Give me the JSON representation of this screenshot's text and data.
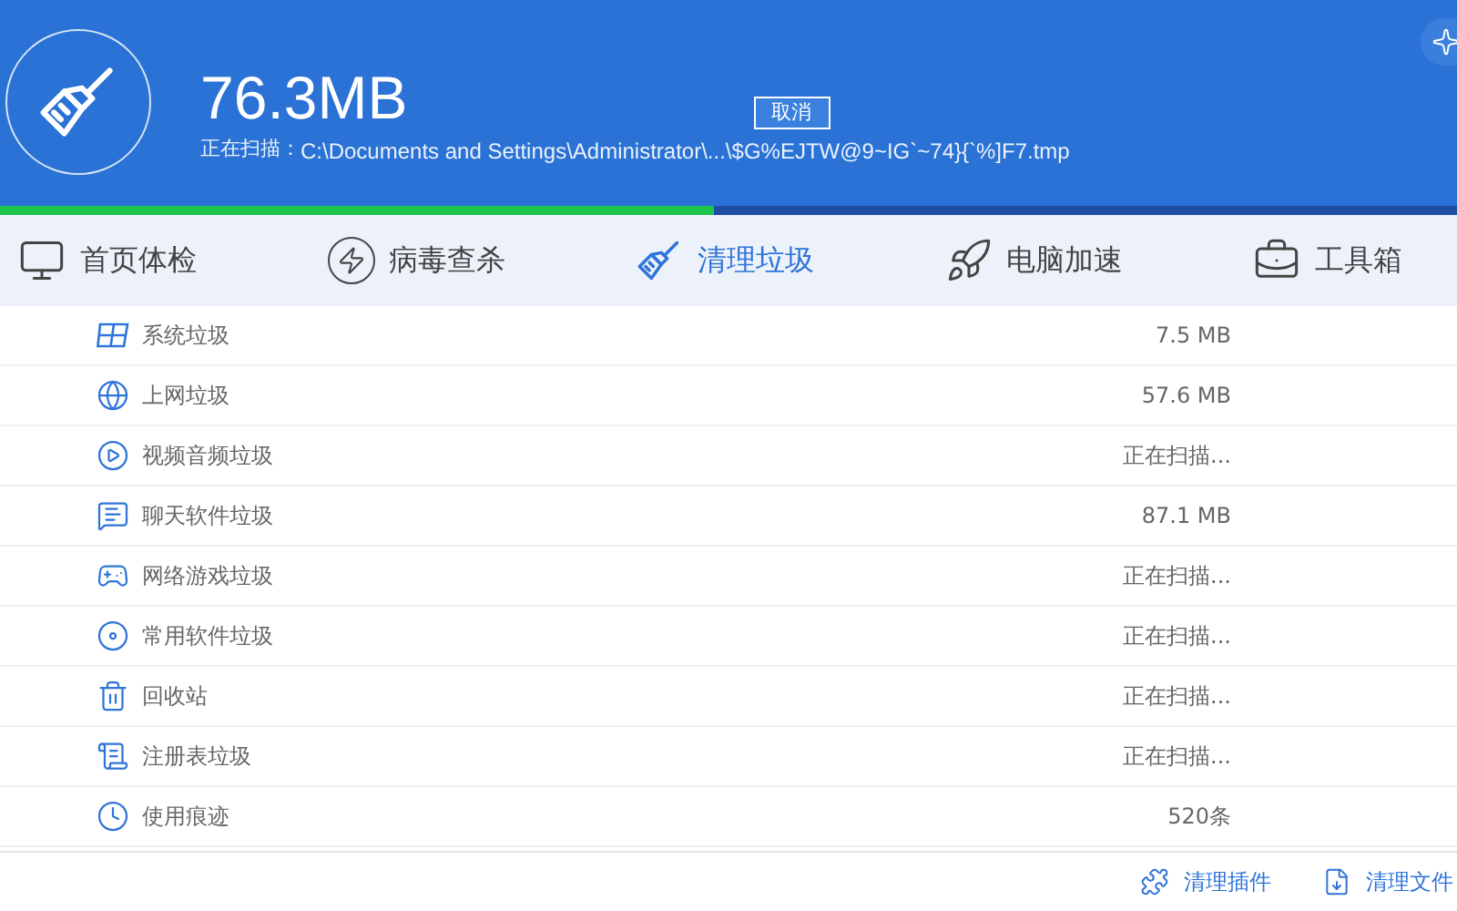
{
  "header": {
    "size": "76.3MB",
    "cancel_button": "取消",
    "scan_label": "正在扫描：",
    "scan_path": "C:\\Documents and Settings\\Administrator\\...\\$G%EJTW@9~IG`~74}{`%]F7.tmp"
  },
  "progress": {
    "level": 0.49
  },
  "tabs": [
    {
      "label": "首页体检",
      "kind": "monitor",
      "selected": false
    },
    {
      "label": "病毒查杀",
      "kind": "bolt",
      "selected": false
    },
    {
      "label": "清理垃圾",
      "kind": "broom",
      "selected": true
    },
    {
      "label": "电脑加速",
      "kind": "rocket",
      "selected": false
    },
    {
      "label": "工具箱",
      "kind": "toolbox",
      "selected": false
    }
  ],
  "items": [
    {
      "name": "系统垃圾",
      "kind": "windows",
      "value": "7.5 MB"
    },
    {
      "name": "上网垃圾",
      "kind": "globe",
      "value": "57.6 MB"
    },
    {
      "name": "视频音频垃圾",
      "kind": "play",
      "value": "正在扫描..."
    },
    {
      "name": "聊天软件垃圾",
      "kind": "chat",
      "value": "87.1 MB"
    },
    {
      "name": "网络游戏垃圾",
      "kind": "gamepad",
      "value": "正在扫描..."
    },
    {
      "name": "常用软件垃圾",
      "kind": "disc",
      "value": "正在扫描..."
    },
    {
      "name": "回收站",
      "kind": "trash",
      "value": "正在扫描..."
    },
    {
      "name": "注册表垃圾",
      "kind": "registry",
      "value": "正在扫描..."
    },
    {
      "name": "使用痕迹",
      "kind": "clock",
      "value": "520条"
    }
  ],
  "footer": [
    {
      "label": "清理插件",
      "kind": "puzzle"
    },
    {
      "label": "清理文件",
      "kind": "download"
    }
  ]
}
